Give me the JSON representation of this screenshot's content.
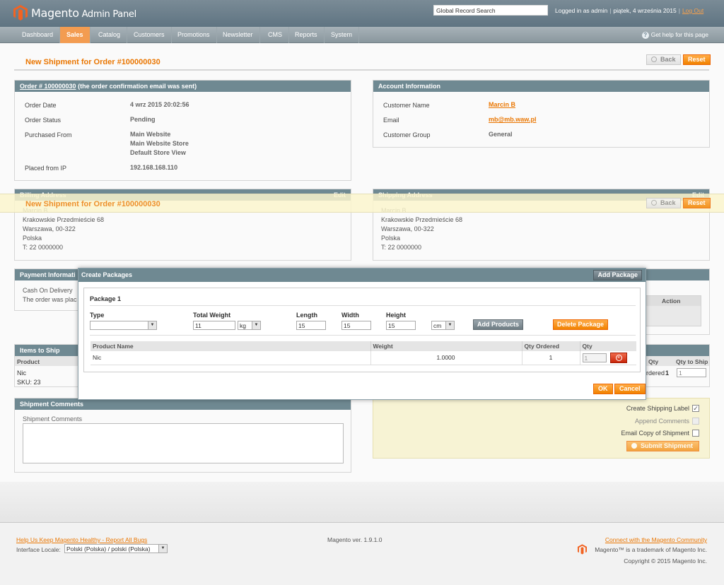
{
  "header": {
    "logo_name": "Magento",
    "logo_sub": "Admin Panel",
    "search_placeholder": "Global Record Search",
    "logged_in": "Logged in as admin",
    "date": "piątek, 4 września 2015",
    "logout": "Log Out"
  },
  "nav": {
    "items": [
      "Dashboard",
      "Sales",
      "Catalog",
      "Customers",
      "Promotions",
      "Newsletter",
      "CMS",
      "Reports",
      "System"
    ],
    "active": "Sales",
    "help": "Get help for this page"
  },
  "page": {
    "title": "New Shipment for Order #100000030",
    "back": "Back",
    "reset": "Reset"
  },
  "order": {
    "heading_link": "Order # 100000030",
    "heading_rest": " (the order confirmation email was sent)",
    "date_label": "Order Date",
    "date_value": "4 wrz 2015 20:02:56",
    "status_label": "Order Status",
    "status_value": "Pending",
    "purchased_label": "Purchased From",
    "purchased_line1": "Main Website",
    "purchased_line2": "Main Website Store",
    "purchased_line3": "Default Store View",
    "ip_label": "Placed from IP",
    "ip_value": "192.168.168.110"
  },
  "account": {
    "heading": "Account Information",
    "name_label": "Customer Name",
    "name_value": "Marcin B",
    "email_label": "Email",
    "email_value": "mb@mb.waw.pl",
    "group_label": "Customer Group",
    "group_value": "General"
  },
  "billing": {
    "heading": "Billing Address",
    "edit": "Edit",
    "name": "Marcin B",
    "street": "Krakowskie Przedmieście 68",
    "city": "Warszawa, 00-322",
    "country": "Polska",
    "phone": "T: 22 0000000"
  },
  "shipping": {
    "heading": "Shipping Address",
    "edit": "Edit",
    "name": "Marcin B",
    "street": "Krakowskie Przedmieście 68",
    "city": "Warszawa, 00-322",
    "country": "Polska",
    "phone": "T: 22 0000000"
  },
  "payment": {
    "heading": "Payment Informati",
    "method": "Cash On Delivery",
    "note": "The order was plac",
    "action_header": "Action"
  },
  "items": {
    "heading": "Items to Ship",
    "col_product": "Product",
    "product_name": "Nic",
    "product_sku": "SKU: 23",
    "col_qty": "Qty",
    "col_qty_ship": "Qty to Ship",
    "ordered_text": "rdered",
    "ordered_qty": "1",
    "ship_qty": "1"
  },
  "comments": {
    "heading": "Shipment Comments",
    "label": "Shipment Comments"
  },
  "submit_panel": {
    "create_label": "Create Shipping Label",
    "append": "Append Comments",
    "email_copy": "Email Copy of Shipment",
    "submit": "Submit Shipment"
  },
  "modal": {
    "title": "Create Packages",
    "add_package": "Add Package",
    "package_title": "Package 1",
    "type_label": "Type",
    "weight_label": "Total Weight",
    "weight_value": "11",
    "weight_unit": "kg",
    "length_label": "Length",
    "length_value": "15",
    "width_label": "Width",
    "width_value": "15",
    "height_label": "Height",
    "height_value": "15",
    "dim_unit": "cm",
    "add_products": "Add Products",
    "delete_package": "Delete Package",
    "table_headers": [
      "Product Name",
      "Weight",
      "Qty Ordered",
      "Qty"
    ],
    "row": {
      "name": "Nic",
      "weight": "1.0000",
      "qty_ordered": "1",
      "qty": "1"
    },
    "ok": "OK",
    "cancel": "Cancel"
  },
  "footer": {
    "help_link": "Help Us Keep Magento Healthy - Report All Bugs",
    "locale_label": "Interface Locale:",
    "locale_value": "Polski (Polska) / polski (Polska)",
    "version": "Magento ver. 1.9.1.0",
    "community": "Connect with the Magento Community",
    "trademark": "Magento™ is a trademark of Magento Inc.",
    "copyright": "Copyright © 2015 Magento Inc."
  }
}
